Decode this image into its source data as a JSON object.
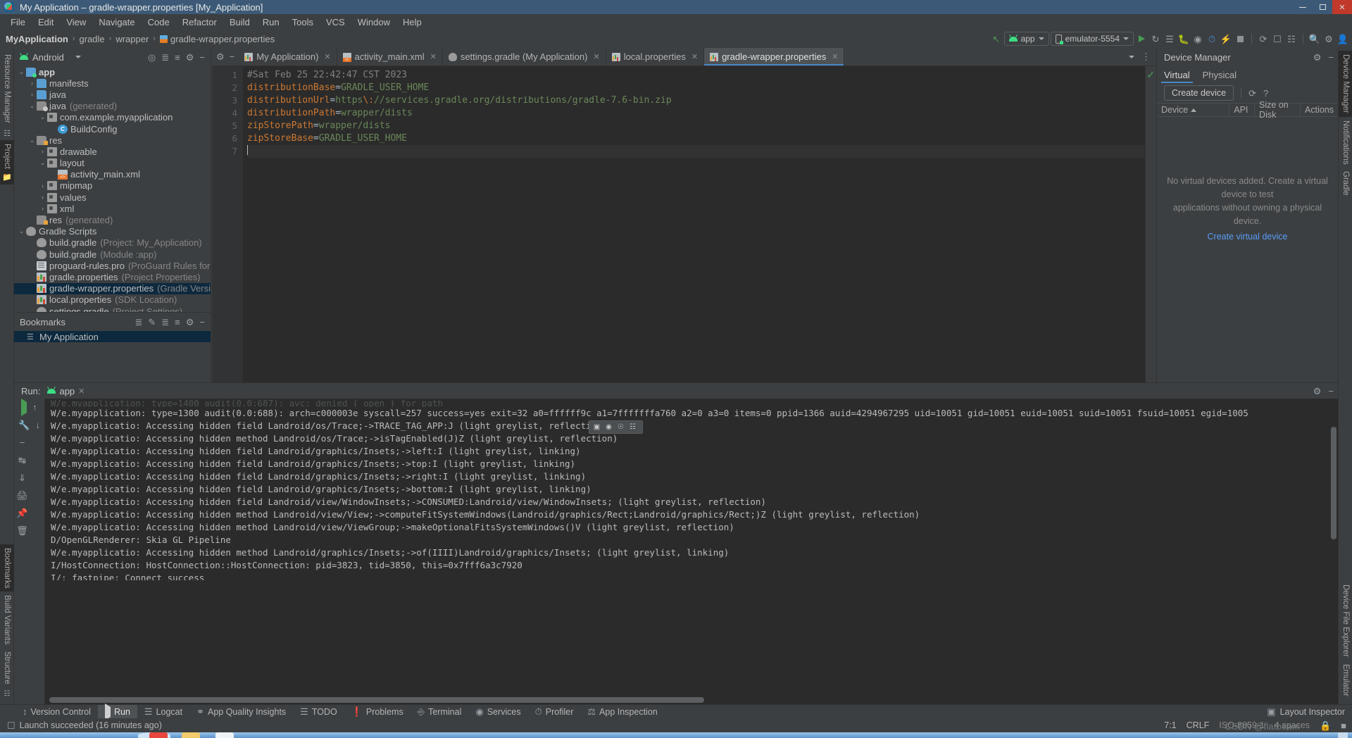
{
  "window": {
    "title": "My Application – gradle-wrapper.properties [My_Application]",
    "app_icon": "android-studio-icon",
    "controls": {
      "minimize": "minimize-icon",
      "maximize": "maximize-icon",
      "close": "close-icon"
    }
  },
  "menubar": [
    {
      "label": "File"
    },
    {
      "label": "Edit"
    },
    {
      "label": "View"
    },
    {
      "label": "Navigate"
    },
    {
      "label": "Code"
    },
    {
      "label": "Refactor"
    },
    {
      "label": "Build"
    },
    {
      "label": "Run"
    },
    {
      "label": "Tools"
    },
    {
      "label": "VCS"
    },
    {
      "label": "Window"
    },
    {
      "label": "Help"
    }
  ],
  "breadcrumb": {
    "items": [
      "MyApplication",
      "gradle",
      "wrapper",
      "gradle-wrapper.properties"
    ],
    "separator": "›"
  },
  "run_toolbar": {
    "back_icon": "back-arrow-icon",
    "module_selector": {
      "label": "app",
      "icon": "android-icon",
      "caret": "chevron-down-icon"
    },
    "device_selector": {
      "label": "emulator-5554",
      "icon": "device-phone-icon",
      "caret": "chevron-down-icon"
    },
    "actions": [
      "run-icon",
      "debug-attach-icon",
      "run-with-coverage-icon",
      "debug-icon",
      "attach-debugger-icon",
      "profiler-icon",
      "apply-changes-icon",
      "stop-icon"
    ],
    "sync_actions": [
      "gradle-sync-icon",
      "avd-manager-icon",
      "sdk-manager-icon"
    ],
    "right_actions": [
      "search-icon",
      "settings-gear-icon",
      "account-avatar-icon"
    ]
  },
  "left_stripe": {
    "top": [
      {
        "label": "Resource Manager",
        "active": false
      },
      {
        "label": "Project",
        "active": true
      }
    ],
    "bottom": [
      {
        "label": "Bookmarks",
        "active": false
      },
      {
        "label": "Build Variants",
        "active": false
      },
      {
        "label": "Structure",
        "active": false
      }
    ]
  },
  "right_stripe": {
    "items": [
      {
        "label": "Device Manager"
      },
      {
        "label": "Notifications"
      },
      {
        "label": "Gradle"
      },
      {
        "label": "Device File Explorer"
      },
      {
        "label": "Emulator"
      }
    ]
  },
  "project_panel": {
    "title": "Android",
    "caret": "chevron-down-icon",
    "actions": [
      "select-opened-file-icon",
      "expand-all-icon",
      "collapse-all-icon",
      "settings-gear-icon",
      "hide-icon"
    ],
    "tree": [
      {
        "depth": 0,
        "arrow": "⌄",
        "icon": "folder-src",
        "label": "app",
        "suffix": "",
        "bold": true,
        "selected": false
      },
      {
        "depth": 1,
        "arrow": "›",
        "icon": "folder",
        "label": "manifests",
        "suffix": "",
        "bold": false,
        "selected": false
      },
      {
        "depth": 1,
        "arrow": "›",
        "icon": "folder",
        "label": "java",
        "suffix": "",
        "bold": false,
        "selected": false
      },
      {
        "depth": 1,
        "arrow": "⌄",
        "icon": "folder-gen",
        "label": "java",
        "suffix": "(generated)",
        "bold": false,
        "selected": false
      },
      {
        "depth": 2,
        "arrow": "⌄",
        "icon": "pkg",
        "label": "com.example.myapplication",
        "suffix": "",
        "bold": false,
        "selected": false
      },
      {
        "depth": 3,
        "arrow": "",
        "icon": "cls",
        "label": "BuildConfig",
        "suffix": "",
        "bold": false,
        "selected": false
      },
      {
        "depth": 1,
        "arrow": "⌄",
        "icon": "folder-res",
        "label": "res",
        "suffix": "",
        "bold": false,
        "selected": false
      },
      {
        "depth": 2,
        "arrow": "›",
        "icon": "pkg",
        "label": "drawable",
        "suffix": "",
        "bold": false,
        "selected": false
      },
      {
        "depth": 2,
        "arrow": "⌄",
        "icon": "pkg",
        "label": "layout",
        "suffix": "",
        "bold": false,
        "selected": false
      },
      {
        "depth": 3,
        "arrow": "",
        "icon": "xmlf",
        "label": "activity_main.xml",
        "suffix": "",
        "bold": false,
        "selected": false
      },
      {
        "depth": 2,
        "arrow": "›",
        "icon": "pkg",
        "label": "mipmap",
        "suffix": "",
        "bold": false,
        "selected": false
      },
      {
        "depth": 2,
        "arrow": "›",
        "icon": "pkg",
        "label": "values",
        "suffix": "",
        "bold": false,
        "selected": false
      },
      {
        "depth": 2,
        "arrow": "›",
        "icon": "pkg",
        "label": "xml",
        "suffix": "",
        "bold": false,
        "selected": false
      },
      {
        "depth": 1,
        "arrow": "",
        "icon": "folder-res",
        "label": "res",
        "suffix": "(generated)",
        "bold": false,
        "selected": false
      },
      {
        "depth": 0,
        "arrow": "⌄",
        "icon": "gradle",
        "label": "Gradle Scripts",
        "suffix": "",
        "bold": false,
        "selected": false
      },
      {
        "depth": 1,
        "arrow": "",
        "icon": "gradle",
        "label": "build.gradle",
        "suffix": "(Project: My_Application)",
        "bold": false,
        "selected": false
      },
      {
        "depth": 1,
        "arrow": "",
        "icon": "gradle",
        "label": "build.gradle",
        "suffix": "(Module :app)",
        "bold": false,
        "selected": false
      },
      {
        "depth": 1,
        "arrow": "",
        "icon": "pro",
        "label": "proguard-rules.pro",
        "suffix": "(ProGuard Rules for \":app\")",
        "bold": false,
        "selected": false
      },
      {
        "depth": 1,
        "arrow": "",
        "icon": "props",
        "label": "gradle.properties",
        "suffix": "(Project Properties)",
        "bold": false,
        "selected": false
      },
      {
        "depth": 1,
        "arrow": "",
        "icon": "props",
        "label": "gradle-wrapper.properties",
        "suffix": "(Gradle Version)",
        "bold": false,
        "selected": true
      },
      {
        "depth": 1,
        "arrow": "",
        "icon": "props",
        "label": "local.properties",
        "suffix": "(SDK Location)",
        "bold": false,
        "selected": false
      },
      {
        "depth": 1,
        "arrow": "",
        "icon": "gradle",
        "label": "settings.gradle",
        "suffix": "(Project Settings)",
        "bold": false,
        "selected": false
      }
    ]
  },
  "bookmarks_panel": {
    "title": "Bookmarks",
    "actions": [
      "add-bookmark-icon",
      "edit-icon",
      "expand-all-icon",
      "collapse-all-icon",
      "settings-gear-icon",
      "hide-icon"
    ],
    "items": [
      {
        "label": "My Application",
        "icon": "bookmark-list-icon",
        "selected": true
      }
    ]
  },
  "editor": {
    "tabs": [
      {
        "label": "My Application)",
        "icon": "props-icon",
        "active": false,
        "closable": true
      },
      {
        "label": "activity_main.xml",
        "icon": "xml-icon",
        "active": false,
        "closable": true
      },
      {
        "label": "settings.gradle (My Application)",
        "icon": "gradle-icon",
        "active": false,
        "closable": true
      },
      {
        "label": "local.properties",
        "icon": "props-icon",
        "active": false,
        "closable": true
      },
      {
        "label": "gradle-wrapper.properties",
        "icon": "props-icon",
        "active": true,
        "closable": true
      }
    ],
    "tab_overflow_icon": "chevron-down-icon",
    "tab_options_icon": "more-options-icon",
    "inspection_status_icon": "checkmark-ok-icon",
    "lines": [
      {
        "n": 1,
        "type": "comment",
        "text": "#Sat Feb 25 22:42:47 CST 2023"
      },
      {
        "n": 2,
        "type": "kv",
        "key": "distributionBase",
        "value": "GRADLE_USER_HOME"
      },
      {
        "n": 3,
        "type": "kv-esc",
        "key": "distributionUrl",
        "value_pre": "https",
        "escape": "\\:",
        "value_post": "//services.gradle.org/distributions/gradle-7.6-bin.zip"
      },
      {
        "n": 4,
        "type": "kv",
        "key": "distributionPath",
        "value": "wrapper/dists"
      },
      {
        "n": 5,
        "type": "kv",
        "key": "zipStorePath",
        "value": "wrapper/dists"
      },
      {
        "n": 6,
        "type": "kv",
        "key": "zipStoreBase",
        "value": "GRADLE_USER_HOME"
      },
      {
        "n": 7,
        "type": "empty",
        "text": ""
      }
    ]
  },
  "device_manager": {
    "title": "Device Manager",
    "header_actions": [
      "settings-gear-icon",
      "hide-icon"
    ],
    "tabs": [
      {
        "label": "Virtual",
        "active": true
      },
      {
        "label": "Physical",
        "active": false
      }
    ],
    "create_button": "Create device",
    "refresh_icon": "refresh-icon",
    "help_icon": "help-icon",
    "columns": [
      {
        "label": "Device",
        "sorted": true,
        "sort_icon": "sort-asc-icon"
      },
      {
        "label": "API",
        "sorted": false
      },
      {
        "label": "Size on Disk",
        "sorted": false
      },
      {
        "label": "Actions",
        "sorted": false
      }
    ],
    "empty_line1": "No virtual devices added. Create a virtual device to test",
    "empty_line2": "applications without owning a physical device.",
    "empty_link": "Create virtual device"
  },
  "run_panel": {
    "label": "Run:",
    "tab": {
      "label": "app",
      "icon": "android-icon",
      "close_icon": "close-icon"
    },
    "header_actions": [
      "settings-gear-icon",
      "hide-icon"
    ],
    "gutter_actions": [
      "rerun-icon",
      "scroll-up-icon",
      "stop-icon",
      "scroll-down-icon",
      "wrench-icon",
      "soft-wrap-icon",
      "scroll-to-end-icon",
      "print-icon",
      "pin-icon",
      "clear-all-icon"
    ],
    "float_toolbar_icons": [
      "split-view-icon",
      "circle-icon",
      "key-icon",
      "drag-handle-icon"
    ],
    "lines": [
      "W/e.myapplication: type=1300 audit(0.0:688): arch=c000003e syscall=257 success=yes exit=32 a0=ffffff9c a1=7fffffffa760 a2=0 a3=0 items=0 ppid=1366 auid=4294967295 uid=10051 gid=10051 euid=10051 suid=10051 fsuid=10051 egid=1005",
      "W/e.myapplicatio: Accessing hidden field Landroid/os/Trace;->TRACE_TAG_APP:J (light greylist, reflection)",
      "W/e.myapplicatio: Accessing hidden method Landroid/os/Trace;->isTagEnabled(J)Z (light greylist, reflection)",
      "W/e.myapplicatio: Accessing hidden field Landroid/graphics/Insets;->left:I (light greylist, linking)",
      "W/e.myapplicatio: Accessing hidden field Landroid/graphics/Insets;->top:I (light greylist, linking)",
      "W/e.myapplicatio: Accessing hidden field Landroid/graphics/Insets;->right:I (light greylist, linking)",
      "W/e.myapplicatio: Accessing hidden field Landroid/graphics/Insets;->bottom:I (light greylist, linking)",
      "W/e.myapplicatio: Accessing hidden field Landroid/view/WindowInsets;->CONSUMED:Landroid/view/WindowInsets; (light greylist, reflection)",
      "W/e.myapplicatio: Accessing hidden method Landroid/view/View;->computeFitSystemWindows(Landroid/graphics/Rect;Landroid/graphics/Rect;)Z (light greylist, reflection)",
      "W/e.myapplicatio: Accessing hidden method Landroid/view/ViewGroup;->makeOptionalFitsSystemWindows()V (light greylist, reflection)",
      "D/OpenGLRenderer: Skia GL Pipeline",
      "W/e.myapplicatio: Accessing hidden method Landroid/graphics/Insets;->of(IIII)Landroid/graphics/Insets; (light greylist, linking)",
      "I/HostConnection: HostConnection::HostConnection: pid=3823, tid=3850, this=0x7fff6a3c7920",
      "I/: fastpipe: Connect success"
    ]
  },
  "bottom_bar": {
    "items": [
      {
        "label": "Version Control",
        "icon": "branch-icon",
        "active": false
      },
      {
        "label": "Run",
        "icon": "run-icon",
        "active": true
      },
      {
        "label": "Logcat",
        "icon": "logcat-icon",
        "active": false
      },
      {
        "label": "App Quality Insights",
        "icon": "shield-icon",
        "active": false
      },
      {
        "label": "TODO",
        "icon": "todo-list-icon",
        "active": false
      },
      {
        "label": "Problems",
        "icon": "warning-icon",
        "active": false
      },
      {
        "label": "Terminal",
        "icon": "terminal-icon",
        "active": false
      },
      {
        "label": "Services",
        "icon": "services-icon",
        "active": false
      },
      {
        "label": "Profiler",
        "icon": "profiler-icon",
        "active": false
      },
      {
        "label": "App Inspection",
        "icon": "inspection-icon",
        "active": false
      }
    ],
    "right": [
      {
        "label": "Layout Inspector",
        "icon": "layout-inspector-icon"
      }
    ]
  },
  "status_bar": {
    "message": "Launch succeeded (16 minutes ago)",
    "message_icon": "device-icon",
    "caret_position": "7:1",
    "line_separator": "CRLF",
    "encoding": "ISO-8859-1",
    "indent": "4 spaces",
    "lock_icon": "lock-icon",
    "memory_icon": "memory-indicator-icon",
    "watermark": "CSDN @flatbeam"
  }
}
